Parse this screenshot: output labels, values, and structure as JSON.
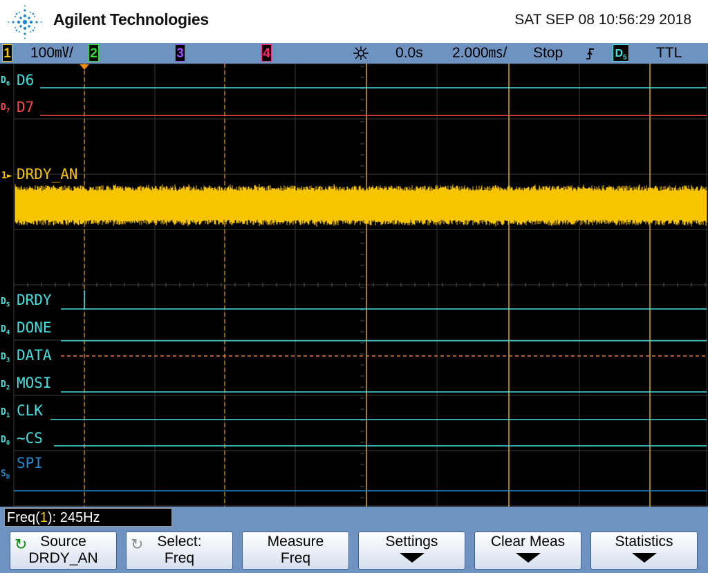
{
  "header": {
    "brand": "Agilent Technologies",
    "datetime": "SAT SEP 08 10:56:29 2018"
  },
  "status": {
    "ch1_num": "1",
    "ch1_scale": "100㎷/",
    "ch2_num": "2",
    "ch3_num": "3",
    "ch4_num": "4",
    "delay": "0.0s",
    "timebase": "2.000㎳/",
    "run_state": "Stop",
    "trigger_src_main": "D",
    "trigger_src_sub": "5",
    "trigger_level": "TTL",
    "colors": {
      "ch1": "#f7c500",
      "ch2": "#33dd33",
      "ch3": "#9b4dff",
      "ch4": "#ff2a6d"
    }
  },
  "traces": {
    "d6": {
      "num_main": "D",
      "num_sub": "6",
      "label": "D6"
    },
    "d7": {
      "num_main": "D",
      "num_sub": "7",
      "label": "D7"
    },
    "ch1": {
      "num_main": "1",
      "label": "DRDY_AN"
    },
    "d5": {
      "num_main": "D",
      "num_sub": "5",
      "label": "DRDY"
    },
    "d4": {
      "num_main": "D",
      "num_sub": "4",
      "label": "DONE"
    },
    "d3": {
      "num_main": "D",
      "num_sub": "3",
      "label": "DATA"
    },
    "d2": {
      "num_main": "D",
      "num_sub": "2",
      "label": "MOSI"
    },
    "d1": {
      "num_main": "D",
      "num_sub": "1",
      "label": "CLK"
    },
    "d0": {
      "num_main": "D",
      "num_sub": "0",
      "label": "~CS"
    },
    "sd": {
      "num_main": "S",
      "num_sub": "D",
      "label": "SPI"
    }
  },
  "measurement": {
    "prefix": "Freq(",
    "channel": "1",
    "suffix": "): 245Hz"
  },
  "softkeys": [
    {
      "line1": "Source",
      "line2": "DRDY_AN"
    },
    {
      "line1": "Select:",
      "line2": "Freq"
    },
    {
      "line1": "Measure",
      "line2": "Freq"
    },
    {
      "line1": "Settings",
      "line2": ""
    },
    {
      "line1": "Clear Meas",
      "line2": ""
    },
    {
      "line1": "Statistics",
      "line2": ""
    }
  ]
}
